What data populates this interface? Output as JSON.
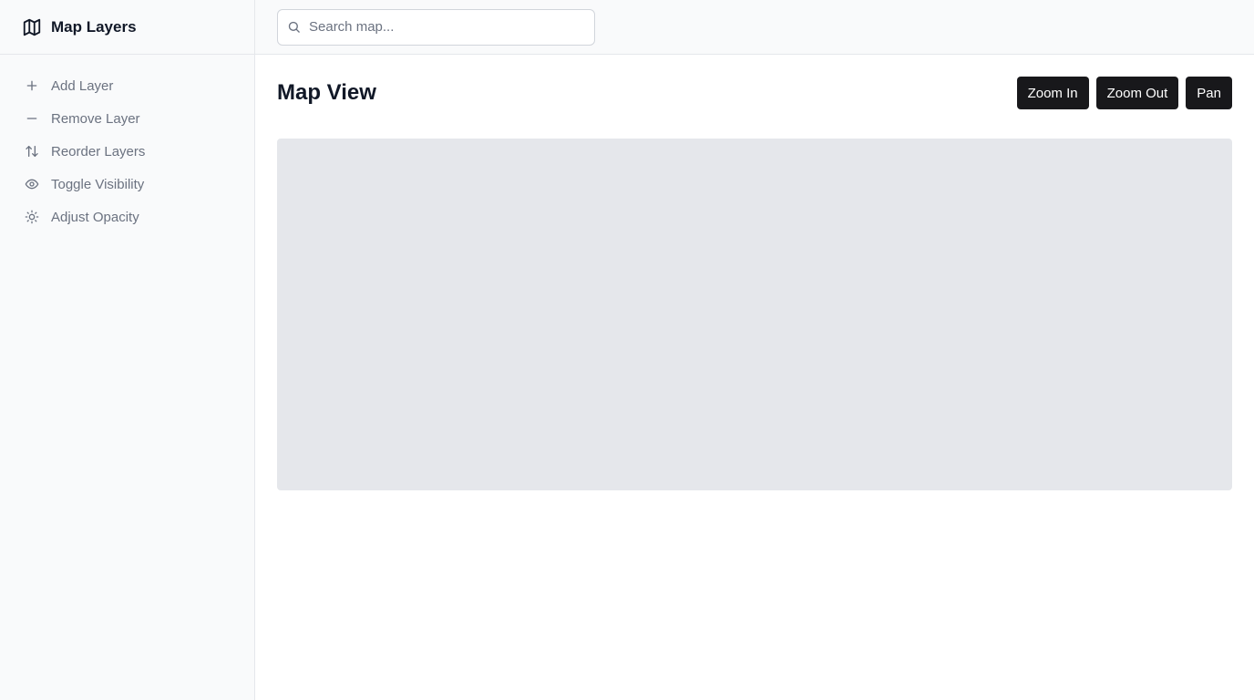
{
  "app": {
    "title": "Map Layers",
    "icon": "map-icon"
  },
  "sidebar": {
    "items": [
      {
        "label": "Add Layer",
        "icon": "plus-icon"
      },
      {
        "label": "Remove Layer",
        "icon": "minus-icon"
      },
      {
        "label": "Reorder Layers",
        "icon": "reorder-arrows-icon"
      },
      {
        "label": "Toggle Visibility",
        "icon": "eye-icon"
      },
      {
        "label": "Adjust Opacity",
        "icon": "sun-icon"
      }
    ]
  },
  "search": {
    "placeholder": "Search map...",
    "value": ""
  },
  "main": {
    "title": "Map View",
    "toolbar": {
      "zoom_in_label": "Zoom In",
      "zoom_out_label": "Zoom Out",
      "pan_label": "Pan"
    }
  },
  "colors": {
    "sidebar_bg": "#f9fafb",
    "button_bg": "#18181b",
    "map_placeholder": "#e5e7eb",
    "muted_text": "#6b7280"
  }
}
